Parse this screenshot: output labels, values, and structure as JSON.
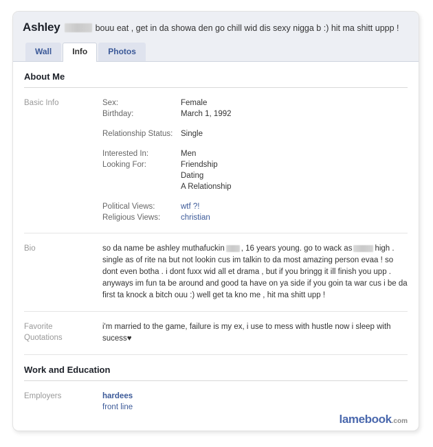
{
  "profile": {
    "name": "Ashley",
    "status_text": "bouu eat , get in da showa den go chill wid dis sexy nigga b :) hit ma shitt uppp !",
    "redacted_surname": true
  },
  "tabs": [
    {
      "label": "Wall",
      "active": false
    },
    {
      "label": "Info",
      "active": true
    },
    {
      "label": "Photos",
      "active": false
    }
  ],
  "sections": {
    "about": {
      "title": "About Me",
      "basic_info": {
        "label": "Basic Info",
        "fields": [
          {
            "key": "Sex:",
            "value": "Female"
          },
          {
            "key": "Birthday:",
            "value": "March 1, 1992"
          },
          {
            "key": "Relationship Status:",
            "value": "Single"
          },
          {
            "key": "Interested In:",
            "value": "Men"
          },
          {
            "key": "Looking For:",
            "value": "Friendship"
          },
          {
            "key": "Political Views:",
            "value": "wtf ?!",
            "link": true
          },
          {
            "key": "Religious Views:",
            "value": "christian",
            "link": true
          }
        ],
        "looking_for_extra": [
          "Dating",
          "A Relationship"
        ]
      },
      "bio": {
        "label": "Bio",
        "text_part_1": "so da name be ashley muthafuckin",
        "text_part_2": ", 16 years young. go to wack as",
        "text_part_3": "high . single as of rite na but not lookin cus im talkin to da most amazing person evaa ! so dont even botha . i dont fuxx wid all et drama , but if you bringg it ill finish you upp . anyways im fun ta be around and good ta have on ya side if you goin ta war cus i be da first ta knock a bitch ouu :) well get ta kno me , hit ma shitt upp !"
      },
      "quotations": {
        "label": "Favorite Quotations",
        "label_line_1": "Favorite",
        "label_line_2": "Quotations",
        "text": "i'm married to the game, failure is my ex, i use to mess with hustle now i sleep with sucess♥"
      }
    },
    "work": {
      "title": "Work and Education",
      "employers": {
        "label": "Employers",
        "name": "hardees",
        "role": "front line"
      }
    }
  },
  "watermark": {
    "brand": "lamebook",
    "tld": ".com"
  },
  "colors": {
    "link": "#3b5998",
    "header_bg": "#edeff4",
    "tab_bg": "#dfe3ee",
    "label_gray": "#999999"
  }
}
